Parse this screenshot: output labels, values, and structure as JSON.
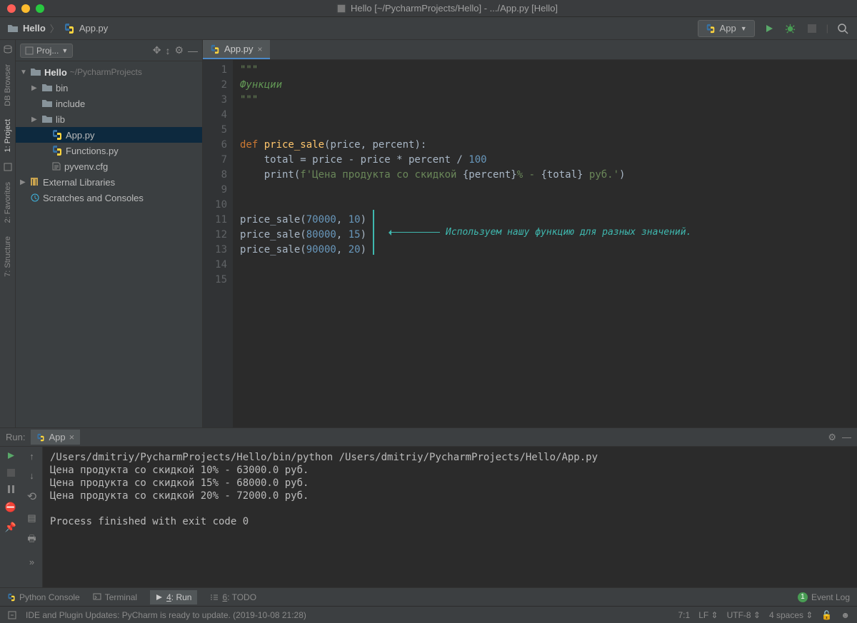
{
  "window": {
    "title": "Hello [~/PycharmProjects/Hello] - .../App.py [Hello]"
  },
  "breadcrumb": {
    "project": "Hello",
    "file": "App.py"
  },
  "toolbar": {
    "run_config": "App"
  },
  "project_panel": {
    "title": "Proj..."
  },
  "tree": {
    "root_name": "Hello",
    "root_path": "~/PycharmProjects",
    "items": [
      {
        "name": "bin",
        "type": "folder"
      },
      {
        "name": "include",
        "type": "folder"
      },
      {
        "name": "lib",
        "type": "folder"
      },
      {
        "name": "App.py",
        "type": "pyfile",
        "selected": true
      },
      {
        "name": "Functions.py",
        "type": "pyfile"
      },
      {
        "name": "pyvenv.cfg",
        "type": "file"
      }
    ],
    "external": "External Libraries",
    "scratches": "Scratches and Consoles"
  },
  "editor_tab": "App.py",
  "code_lines": [
    "\"\"\"",
    "Функции",
    "\"\"\"",
    "",
    "",
    "def price_sale(price, percent):",
    "    total = price - price * percent / 100",
    "    print(f'Цена продукта со скидкой {percent}% - {total} руб.')",
    "",
    "",
    "price_sale(70000, 10)",
    "price_sale(80000, 15)",
    "price_sale(90000, 20)",
    "",
    ""
  ],
  "annotation": "Используем нашу функцию для разных значений.",
  "run": {
    "label": "Run:",
    "tab": "App",
    "output": [
      "/Users/dmitriy/PycharmProjects/Hello/bin/python /Users/dmitriy/PycharmProjects/Hello/App.py",
      "Цена продукта со скидкой 10% - 63000.0 руб.",
      "Цена продукта со скидкой 15% - 68000.0 руб.",
      "Цена продукта со скидкой 20% - 72000.0 руб.",
      "",
      "Process finished with exit code 0"
    ]
  },
  "bottom_tabs": {
    "console": "Python Console",
    "terminal": "Terminal",
    "run": "4: Run",
    "todo": "6: TODO",
    "eventlog": "Event Log"
  },
  "status": {
    "message": "IDE and Plugin Updates: PyCharm is ready to update. (2019-10-08 21:28)",
    "pos": "7:1",
    "sep": "LF",
    "enc": "UTF-8",
    "indent": "4 spaces"
  },
  "side_tabs": {
    "db": "DB Browser",
    "project": "1: Project",
    "favorites": "2: Favorites",
    "structure": "7: Structure"
  }
}
